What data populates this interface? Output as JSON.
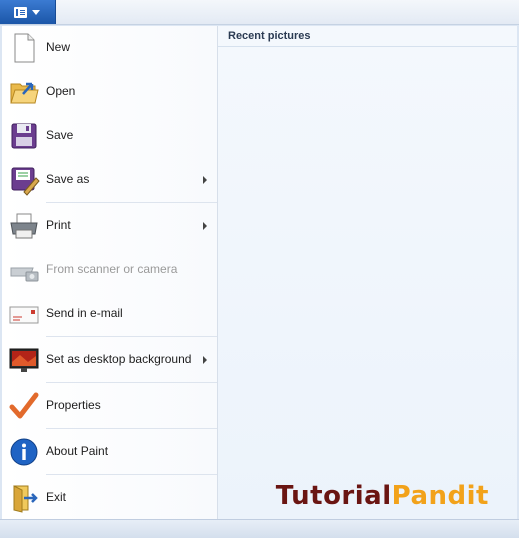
{
  "menu": {
    "items": [
      {
        "id": "new",
        "label": "New",
        "icon": "new-document-icon",
        "submenu": false,
        "disabled": false
      },
      {
        "id": "open",
        "label": "Open",
        "icon": "open-folder-icon",
        "submenu": false,
        "disabled": false
      },
      {
        "id": "save",
        "label": "Save",
        "icon": "save-disk-icon",
        "submenu": false,
        "disabled": false
      },
      {
        "id": "save-as",
        "label": "Save as",
        "icon": "save-as-icon",
        "submenu": true,
        "disabled": false
      },
      {
        "id": "print",
        "label": "Print",
        "icon": "printer-icon",
        "submenu": true,
        "disabled": false
      },
      {
        "id": "scanner",
        "label": "From scanner or camera",
        "icon": "scanner-camera-icon",
        "submenu": false,
        "disabled": true
      },
      {
        "id": "email",
        "label": "Send in e-mail",
        "icon": "email-envelope-icon",
        "submenu": false,
        "disabled": false
      },
      {
        "id": "desktop-bg",
        "label": "Set as desktop background",
        "icon": "desktop-background-icon",
        "submenu": true,
        "disabled": false
      },
      {
        "id": "properties",
        "label": "Properties",
        "icon": "checkmark-icon",
        "submenu": false,
        "disabled": false
      },
      {
        "id": "about",
        "label": "About Paint",
        "icon": "info-icon",
        "submenu": false,
        "disabled": false
      },
      {
        "id": "exit",
        "label": "Exit",
        "icon": "exit-icon",
        "submenu": false,
        "disabled": false
      }
    ]
  },
  "recent": {
    "title": "Recent pictures"
  },
  "watermark": {
    "part1": "Tutorial",
    "part2": "Pandit"
  },
  "colors": {
    "accent": "#2a66bb",
    "wm1": "#6a1512",
    "wm2": "#f2a21a"
  }
}
